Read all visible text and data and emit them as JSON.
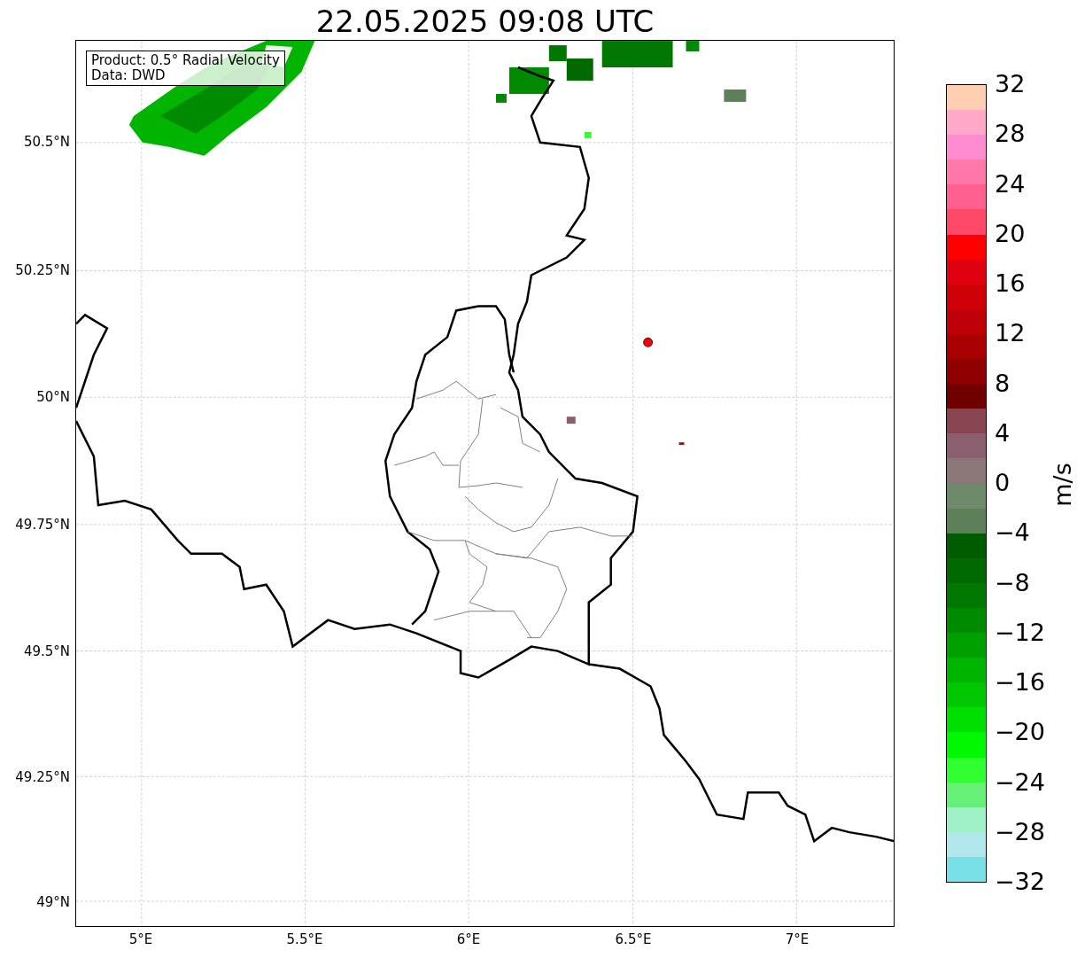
{
  "title": "22.05.2025 09:08 UTC",
  "info_box": [
    "Product: 0.5° Radial Velocity",
    "Data: DWD"
  ],
  "y_ticks": [
    "50.5°N",
    "50.25°N",
    "50°N",
    "49.75°N",
    "49.5°N",
    "49.25°N",
    "49°N"
  ],
  "x_ticks": [
    "5°E",
    "5.5°E",
    "6°E",
    "6.5°E",
    "7°E"
  ],
  "colorbar": {
    "label": "m/s",
    "ticks": [
      "32",
      "28",
      "24",
      "20",
      "16",
      "12",
      "8",
      "4",
      "0",
      "−4",
      "−8",
      "−12",
      "−16",
      "−20",
      "−24",
      "−28",
      "−32"
    ],
    "segments": [
      {
        "color": "#fecfb0"
      },
      {
        "color": "#ffa8c8"
      },
      {
        "color": "#ff8cd0"
      },
      {
        "color": "#ff78a8"
      },
      {
        "color": "#ff6090"
      },
      {
        "color": "#ff4868"
      },
      {
        "color": "#ff0000"
      },
      {
        "color": "#e00010"
      },
      {
        "color": "#d00008"
      },
      {
        "color": "#c00008"
      },
      {
        "color": "#a80000"
      },
      {
        "color": "#900000"
      },
      {
        "color": "#700000"
      },
      {
        "color": "#884450"
      },
      {
        "color": "#8a6070"
      },
      {
        "color": "#8a7878"
      },
      {
        "color": "#6f8a6a"
      },
      {
        "color": "#5e8058"
      },
      {
        "color": "#005c00"
      },
      {
        "color": "#006a00"
      },
      {
        "color": "#007800"
      },
      {
        "color": "#008a00"
      },
      {
        "color": "#00a000"
      },
      {
        "color": "#00b400"
      },
      {
        "color": "#00c800"
      },
      {
        "color": "#00e000"
      },
      {
        "color": "#00f800"
      },
      {
        "color": "#30ff30"
      },
      {
        "color": "#66f077"
      },
      {
        "color": "#a0f0c8"
      },
      {
        "color": "#b0e8ee"
      },
      {
        "color": "#78e0e6"
      }
    ]
  }
}
